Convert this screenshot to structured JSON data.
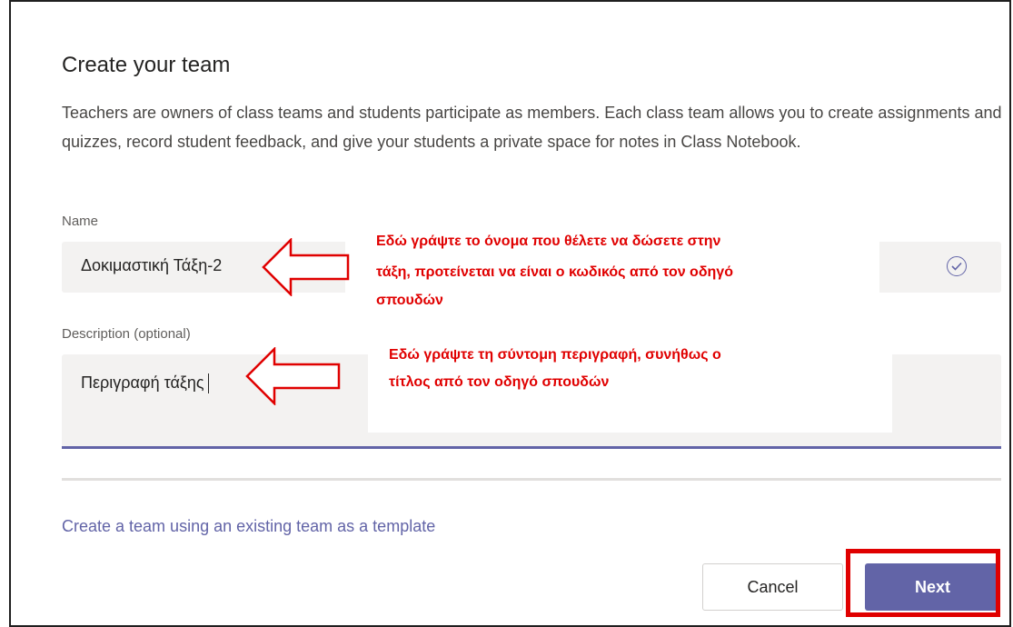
{
  "dialog": {
    "title": "Create your team",
    "description": "Teachers are owners of class teams and students participate as members. Each class team allows you to create assignments and quizzes, record student feedback, and give your students a private space for notes in Class Notebook."
  },
  "form": {
    "name_label": "Name",
    "name_value": "Δοκιμαστική Τάξη-2",
    "description_label": "Description (optional)",
    "description_value": "Περιγραφή τάξης"
  },
  "annotations": {
    "name_note_line1": "Εδώ γράψτε το όνομα που θέλετε να δώσετε στην",
    "name_note_line2": "τάξη, προτείνεται να είναι ο κωδικός από τον οδηγό",
    "name_note_line3": "σπουδών",
    "desc_note_line1": "Εδώ γράψτε τη σύντομη περιγραφή, συνήθως ο",
    "desc_note_line2": "τίτλος από τον οδηγό σπουδών"
  },
  "footer": {
    "template_link": "Create a team using an existing team as a template",
    "cancel_label": "Cancel",
    "next_label": "Next"
  },
  "colors": {
    "accent": "#6264a7",
    "annotation_red": "#e00000"
  },
  "icons": {
    "name_valid": "check-circle-icon",
    "annotation_arrow": "left-arrow-icon"
  }
}
